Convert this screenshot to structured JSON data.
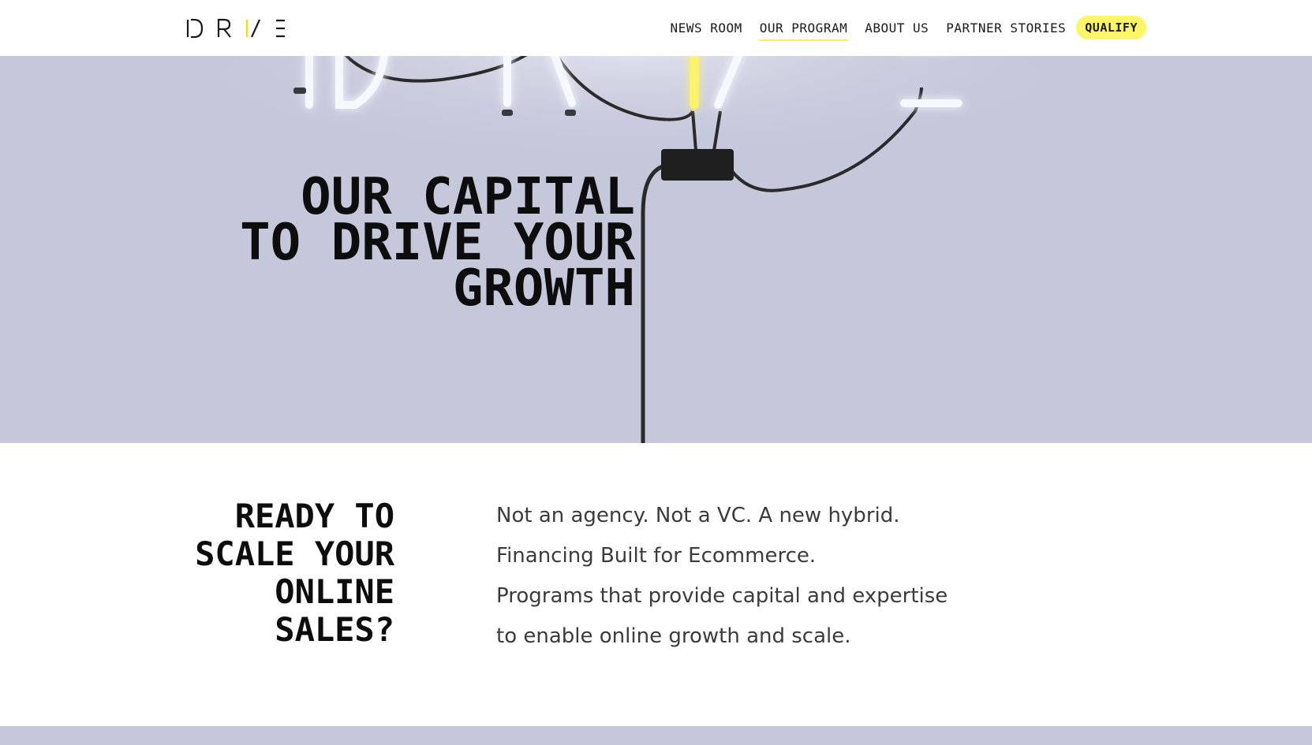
{
  "header": {
    "logo": {
      "letters": [
        "D",
        "R",
        "I",
        "V",
        "E"
      ],
      "icon": "drive-logo",
      "accent_color": "#fff56a"
    },
    "nav": [
      {
        "label": "NEWS ROOM",
        "active": false
      },
      {
        "label": "OUR PROGRAM",
        "active": true
      },
      {
        "label": "ABOUT US",
        "active": false
      },
      {
        "label": "PARTNER STORIES",
        "active": false
      }
    ],
    "cta_label": "QUALIFY"
  },
  "hero": {
    "title_lines": [
      "OUR CAPITAL",
      "TO DRIVE YOUR",
      "GROWTH"
    ],
    "background_color": "#c5c7db",
    "image": "neon-drive-sign"
  },
  "intro": {
    "heading_lines": [
      "READY TO",
      "SCALE YOUR",
      "ONLINE",
      "SALES?"
    ],
    "paragraph_lines": [
      "Not an agency. Not a VC. A new hybrid.",
      "Financing Built for Ecommerce.",
      "Programs that provide capital and expertise",
      "to enable online growth and scale."
    ]
  },
  "colors": {
    "accent": "#fff56a",
    "hero_bg": "#c5c7db",
    "text": "#0d0d0d"
  }
}
